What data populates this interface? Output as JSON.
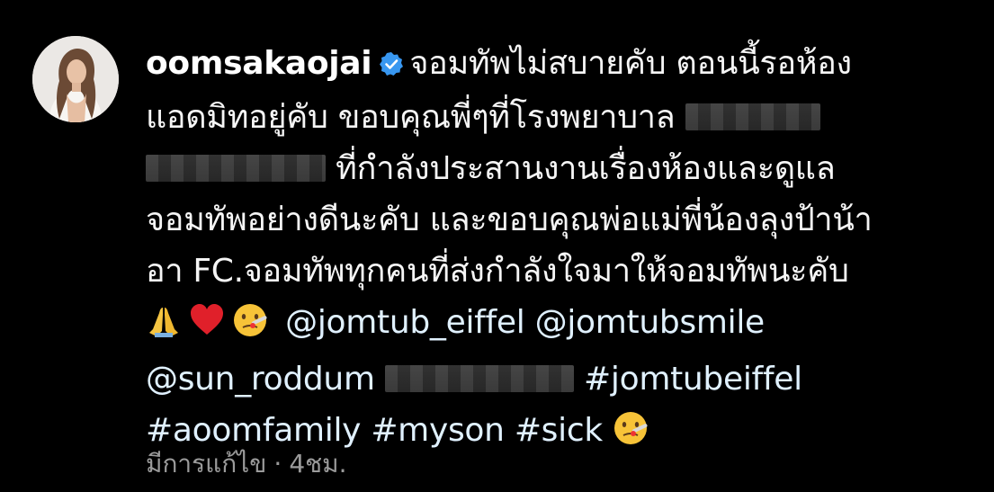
{
  "post": {
    "username": "oomsakaojai",
    "verified": true,
    "caption": {
      "l1": "จอมทัพไม่สบายคับ ตอนนี้รอห้อง",
      "l2": "แอดมิทอยู่คับ ขอบคุณพี่ๆที่โรงพยาบาล",
      "l3": "ที่กำลังประสานงานเรื่องห้องและดูแล",
      "l4": "จอมทัพอย่างดีนะคับ  และขอบคุณพ่อแม่พี่น้องลุงป้าน้า",
      "l5": "อา FC.จอมทัพทุกคนที่ส่งกำลังใจมาให้จอมทัพนะคับ"
    },
    "mentions": [
      "@jomtub_eiffel",
      "@jomtubsmile",
      "@sun_roddum"
    ],
    "hashtags": [
      "#jomtubeiffel",
      "#aoomfamily",
      "#myson",
      "#sick"
    ],
    "emojis": [
      "folded-hands-icon",
      "red-heart-icon",
      "face-with-thermometer-icon"
    ]
  },
  "meta": {
    "edited": "มีการแก้ไข",
    "separator": "·",
    "time": "4ชม."
  },
  "colors": {
    "background": "#000000",
    "text": "#f5f5f5",
    "meta": "#9b9b9b",
    "verified": "#3897f0"
  }
}
